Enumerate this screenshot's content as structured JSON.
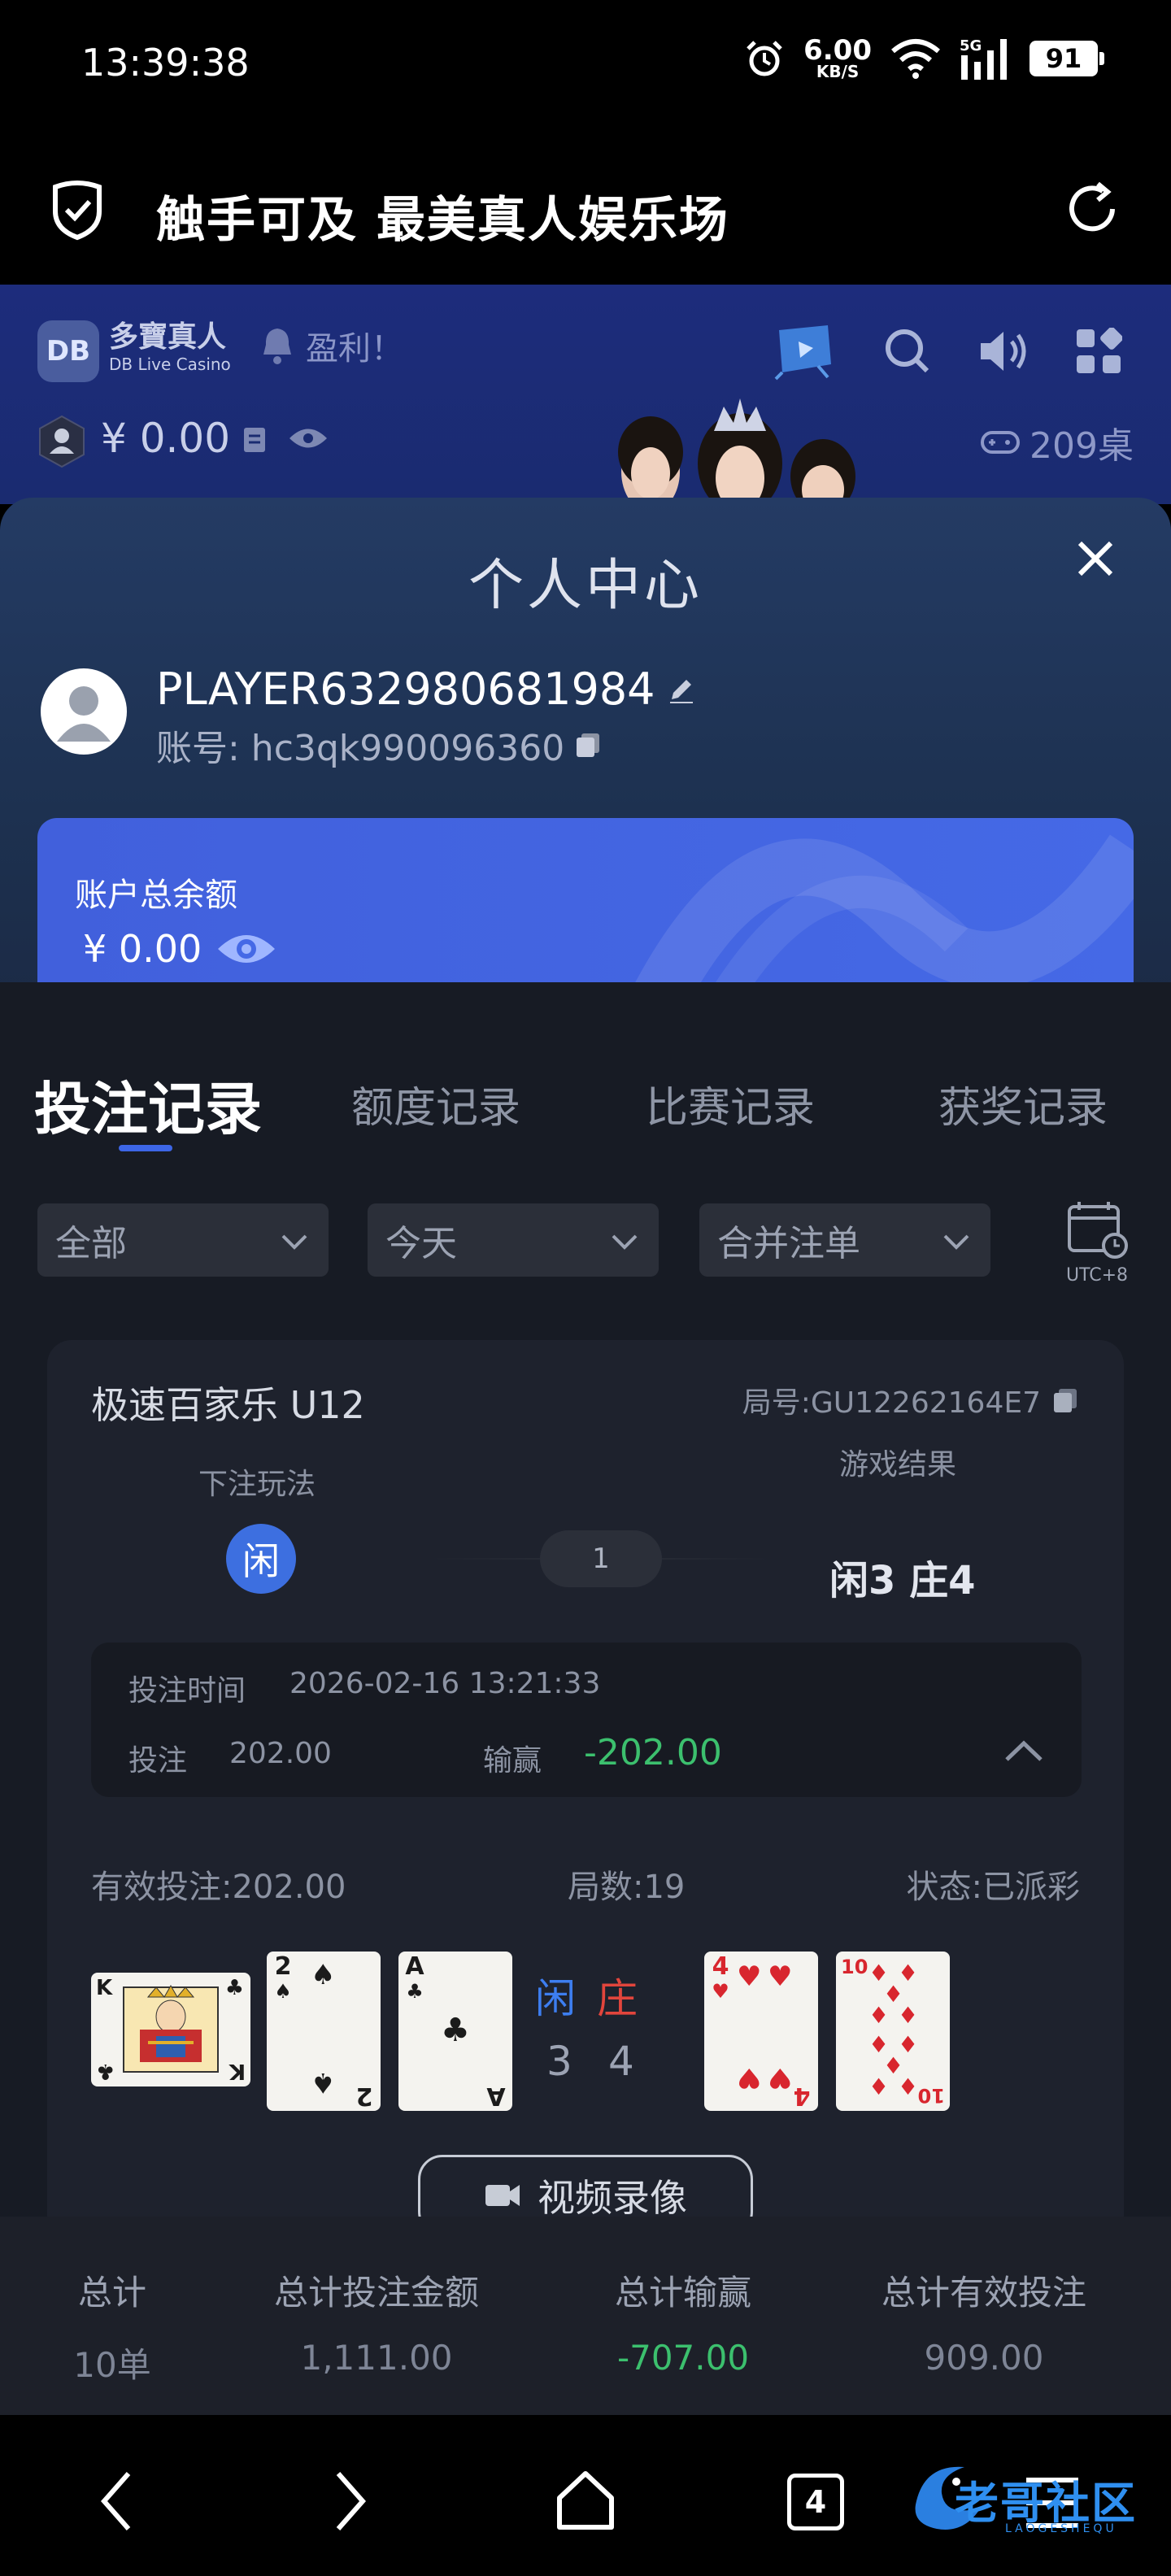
{
  "status_bar": {
    "time": "13:39:38",
    "net_speed_value": "6.00",
    "net_speed_unit": "KB/S",
    "signal_label": "5G",
    "battery": "91"
  },
  "top_bar": {
    "title": "触手可及 最美真人娱乐场"
  },
  "hero": {
    "logo_mark": "DB",
    "brand_cn": "多寶真人",
    "brand_en": "DB Live Casino",
    "ticker": "盈利！",
    "balance": "¥ 0.00",
    "table_count": "209桌"
  },
  "sheet": {
    "title": "个人中心",
    "player_name": "PLAYER632980681984",
    "account": "账号: hc3qk990096360",
    "balance_label": "账户总余额",
    "balance_value": "¥ 0.00"
  },
  "tabs": [
    {
      "label": "投注记录",
      "active": true
    },
    {
      "label": "额度记录"
    },
    {
      "label": "比赛记录"
    },
    {
      "label": "获奖记录"
    }
  ],
  "filters": {
    "type": "全部",
    "date": "今天",
    "mode": "合并注单",
    "timezone": "UTC+8"
  },
  "bet": {
    "game": "极速百家乐 U12",
    "round": "局号:GU12262164E7",
    "play_label": "下注玩法",
    "play_value": "闲",
    "count": "1",
    "result_label": "游戏结果",
    "result_value": "闲3 庄4",
    "time_label": "投注时间",
    "time_value": "2026-02-16 13:21:33",
    "stake_label": "投注",
    "stake_value": "202.00",
    "winloss_label": "输赢",
    "winloss_value": "-202.00",
    "valid_bet": "有效投注:202.00",
    "rounds": "局数:19",
    "status": "状态:已派彩",
    "player_label": "闲",
    "banker_label": "庄",
    "player_score": "3",
    "banker_score": "4",
    "player_cards": [
      {
        "rank": "K",
        "suit": "♣",
        "color": "black"
      },
      {
        "rank": "2",
        "suit": "♠",
        "color": "black"
      },
      {
        "rank": "A",
        "suit": "♣",
        "color": "black"
      }
    ],
    "banker_cards": [
      {
        "rank": "4",
        "suit": "♥",
        "color": "red"
      },
      {
        "rank": "10",
        "suit": "♦",
        "color": "red"
      }
    ],
    "video_button": "视频录像"
  },
  "summary": {
    "total_label": "总计",
    "total_value": "10单",
    "bet_amount_label": "总计投注金额",
    "bet_amount_value": "1,111.00",
    "winloss_label": "总计输赢",
    "winloss_value": "-707.00",
    "valid_label": "总计有效投注",
    "valid_value": "909.00"
  },
  "nav": {
    "tab_count": "4"
  },
  "watermark": {
    "text": "老哥社区",
    "sub": "LAOGESHEQU"
  },
  "colors": {
    "accent_blue": "#3d66e6",
    "card_blue": "#4569e6",
    "win_green": "#3cc06e",
    "banker_red": "#e2453c",
    "player_blue": "#3d7ef0"
  }
}
